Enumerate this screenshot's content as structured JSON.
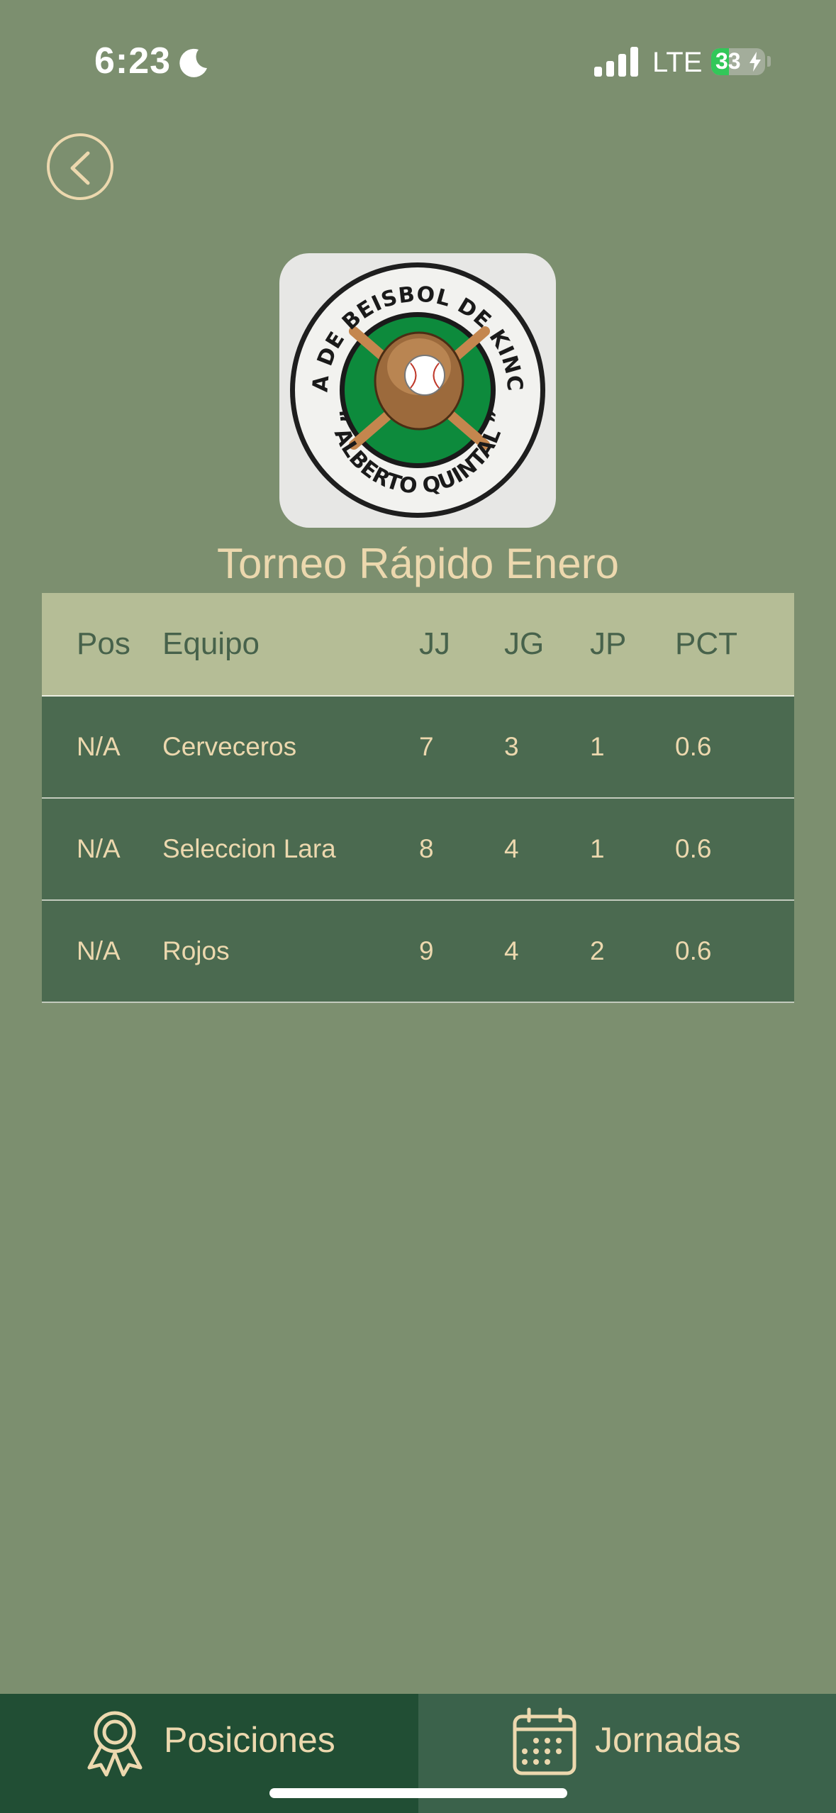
{
  "status_bar": {
    "time": "6:23",
    "network": "LTE",
    "battery_level": "33",
    "battery_fraction": 0.33,
    "battery_color": "#32c759"
  },
  "header": {
    "back_icon": "chevron-left-icon"
  },
  "logo": {
    "top_text": "LIGA DE BEISBOL DE KINCHIL",
    "bottom_text": "“ ALBERTO QUINTAL ”"
  },
  "title": "Torneo Rápido Enero",
  "table": {
    "columns": [
      "Pos",
      "Equipo",
      "JJ",
      "JG",
      "JP",
      "PCT"
    ],
    "rows": [
      {
        "pos": "N/A",
        "team": "Cerveceros",
        "jj": "7",
        "jg": "3",
        "jp": "1",
        "pct": "0.6"
      },
      {
        "pos": "N/A",
        "team": "Seleccion Lara",
        "jj": "8",
        "jg": "4",
        "jp": "1",
        "pct": "0.6"
      },
      {
        "pos": "N/A",
        "team": "Rojos",
        "jj": "9",
        "jg": "4",
        "jp": "2",
        "pct": "0.6"
      }
    ]
  },
  "tabs": [
    {
      "label": "Posiciones",
      "icon": "award-ribbon-icon",
      "active": true
    },
    {
      "label": "Jornadas",
      "icon": "calendar-icon",
      "active": false
    }
  ],
  "colors": {
    "background": "#7c8f6f",
    "accent": "#ecd8ae",
    "header_row": "#b5bd96",
    "data_row": "#4b6a50",
    "tab_active": "#214e34",
    "tab_inactive": "#3b624b"
  }
}
